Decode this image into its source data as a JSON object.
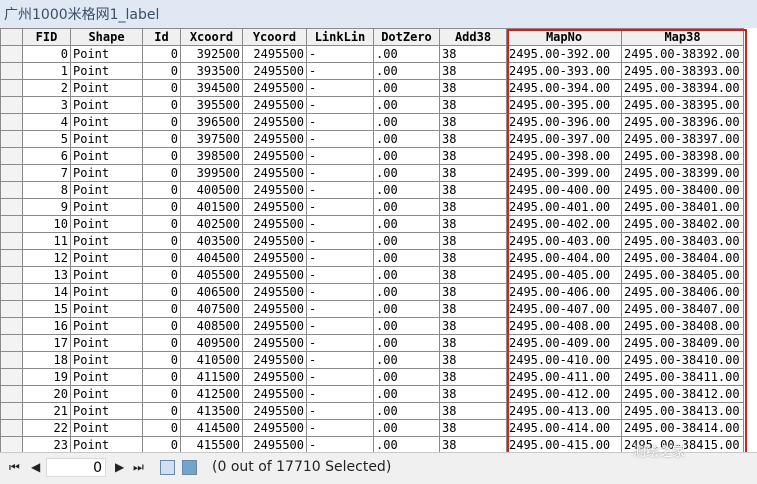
{
  "window": {
    "title": "广州1000米格网1_label"
  },
  "table": {
    "columns": [
      "FID",
      "Shape",
      "Id",
      "Xcoord",
      "Ycoord",
      "LinkLin",
      "DotZero",
      "Add38",
      "MapNo",
      "Map38"
    ],
    "rows": [
      [
        "0",
        "Point",
        "0",
        "392500",
        "2495500",
        "-",
        ".00",
        "38",
        "2495.00-392.00",
        "2495.00-38392.00"
      ],
      [
        "1",
        "Point",
        "0",
        "393500",
        "2495500",
        "-",
        ".00",
        "38",
        "2495.00-393.00",
        "2495.00-38393.00"
      ],
      [
        "2",
        "Point",
        "0",
        "394500",
        "2495500",
        "-",
        ".00",
        "38",
        "2495.00-394.00",
        "2495.00-38394.00"
      ],
      [
        "3",
        "Point",
        "0",
        "395500",
        "2495500",
        "-",
        ".00",
        "38",
        "2495.00-395.00",
        "2495.00-38395.00"
      ],
      [
        "4",
        "Point",
        "0",
        "396500",
        "2495500",
        "-",
        ".00",
        "38",
        "2495.00-396.00",
        "2495.00-38396.00"
      ],
      [
        "5",
        "Point",
        "0",
        "397500",
        "2495500",
        "-",
        ".00",
        "38",
        "2495.00-397.00",
        "2495.00-38397.00"
      ],
      [
        "6",
        "Point",
        "0",
        "398500",
        "2495500",
        "-",
        ".00",
        "38",
        "2495.00-398.00",
        "2495.00-38398.00"
      ],
      [
        "7",
        "Point",
        "0",
        "399500",
        "2495500",
        "-",
        ".00",
        "38",
        "2495.00-399.00",
        "2495.00-38399.00"
      ],
      [
        "8",
        "Point",
        "0",
        "400500",
        "2495500",
        "-",
        ".00",
        "38",
        "2495.00-400.00",
        "2495.00-38400.00"
      ],
      [
        "9",
        "Point",
        "0",
        "401500",
        "2495500",
        "-",
        ".00",
        "38",
        "2495.00-401.00",
        "2495.00-38401.00"
      ],
      [
        "10",
        "Point",
        "0",
        "402500",
        "2495500",
        "-",
        ".00",
        "38",
        "2495.00-402.00",
        "2495.00-38402.00"
      ],
      [
        "11",
        "Point",
        "0",
        "403500",
        "2495500",
        "-",
        ".00",
        "38",
        "2495.00-403.00",
        "2495.00-38403.00"
      ],
      [
        "12",
        "Point",
        "0",
        "404500",
        "2495500",
        "-",
        ".00",
        "38",
        "2495.00-404.00",
        "2495.00-38404.00"
      ],
      [
        "13",
        "Point",
        "0",
        "405500",
        "2495500",
        "-",
        ".00",
        "38",
        "2495.00-405.00",
        "2495.00-38405.00"
      ],
      [
        "14",
        "Point",
        "0",
        "406500",
        "2495500",
        "-",
        ".00",
        "38",
        "2495.00-406.00",
        "2495.00-38406.00"
      ],
      [
        "15",
        "Point",
        "0",
        "407500",
        "2495500",
        "-",
        ".00",
        "38",
        "2495.00-407.00",
        "2495.00-38407.00"
      ],
      [
        "16",
        "Point",
        "0",
        "408500",
        "2495500",
        "-",
        ".00",
        "38",
        "2495.00-408.00",
        "2495.00-38408.00"
      ],
      [
        "17",
        "Point",
        "0",
        "409500",
        "2495500",
        "-",
        ".00",
        "38",
        "2495.00-409.00",
        "2495.00-38409.00"
      ],
      [
        "18",
        "Point",
        "0",
        "410500",
        "2495500",
        "-",
        ".00",
        "38",
        "2495.00-410.00",
        "2495.00-38410.00"
      ],
      [
        "19",
        "Point",
        "0",
        "411500",
        "2495500",
        "-",
        ".00",
        "38",
        "2495.00-411.00",
        "2495.00-38411.00"
      ],
      [
        "20",
        "Point",
        "0",
        "412500",
        "2495500",
        "-",
        ".00",
        "38",
        "2495.00-412.00",
        "2495.00-38412.00"
      ],
      [
        "21",
        "Point",
        "0",
        "413500",
        "2495500",
        "-",
        ".00",
        "38",
        "2495.00-413.00",
        "2495.00-38413.00"
      ],
      [
        "22",
        "Point",
        "0",
        "414500",
        "2495500",
        "-",
        ".00",
        "38",
        "2495.00-414.00",
        "2495.00-38414.00"
      ],
      [
        "23",
        "Point",
        "0",
        "415500",
        "2495500",
        "-",
        ".00",
        "38",
        "2495.00-415.00",
        "2495.00-38415.00"
      ]
    ]
  },
  "footer": {
    "first_icon": "first-record-icon",
    "prev_icon": "previous-record-icon",
    "record_value": "0",
    "next_icon": "next-record-icon",
    "last_icon": "last-record-icon",
    "show_all_icon": "show-all-records-icon",
    "show_selected_icon": "show-selected-records-icon",
    "status": "(0 out of 17710 Selected)"
  },
  "watermark": {
    "text": "测绘之家"
  },
  "colors": {
    "highlight": "#e01919"
  }
}
